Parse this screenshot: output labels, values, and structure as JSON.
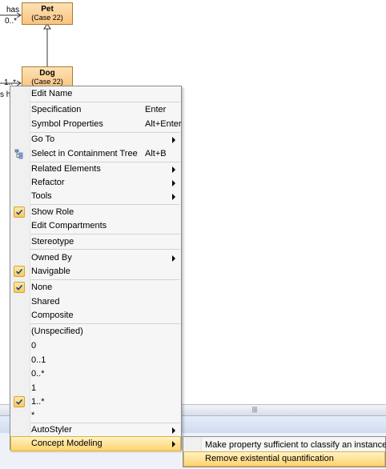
{
  "diagram": {
    "classes": [
      {
        "name": "Pet",
        "case": "(Case 22)"
      },
      {
        "name": "Dog",
        "case": "(Case 22)"
      }
    ],
    "labels": {
      "has_top": "has",
      "mult_top": "0..*",
      "mult_dog": "1..*",
      "has_partial": "s h"
    }
  },
  "scrollbar": {
    "grip": "|||"
  },
  "menu": {
    "items": [
      {
        "label": "Edit Name"
      },
      {
        "label": "Specification",
        "shortcut": "Enter"
      },
      {
        "label": "Symbol Properties",
        "shortcut": "Alt+Enter"
      },
      {
        "label": "Go To"
      },
      {
        "label": "Select in Containment Tree",
        "shortcut": "Alt+B"
      },
      {
        "label": "Related Elements"
      },
      {
        "label": "Refactor"
      },
      {
        "label": "Tools"
      },
      {
        "label": "Show Role",
        "checked": true
      },
      {
        "label": "Edit Compartments"
      },
      {
        "label": "Stereotype"
      },
      {
        "label": "Owned By"
      },
      {
        "label": "Navigable",
        "checked": true
      },
      {
        "label": "None",
        "checked": true
      },
      {
        "label": "Shared"
      },
      {
        "label": "Composite"
      },
      {
        "label": "(Unspecified)"
      },
      {
        "label": "0"
      },
      {
        "label": "0..1"
      },
      {
        "label": "0..*"
      },
      {
        "label": "1"
      },
      {
        "label": "1..*",
        "checked": true
      },
      {
        "label": "*"
      },
      {
        "label": "AutoStyler"
      },
      {
        "label": "Concept Modeling",
        "highlighted": true
      }
    ]
  },
  "submenu": {
    "items": [
      {
        "label": "Make property sufficient to classify an instance"
      },
      {
        "label": "Remove existential quantification",
        "highlighted": true
      }
    ]
  },
  "colors": {
    "highlight": "#ffd36d",
    "check_bg": "#f8c95a",
    "class_fill": "#f9c47f"
  }
}
